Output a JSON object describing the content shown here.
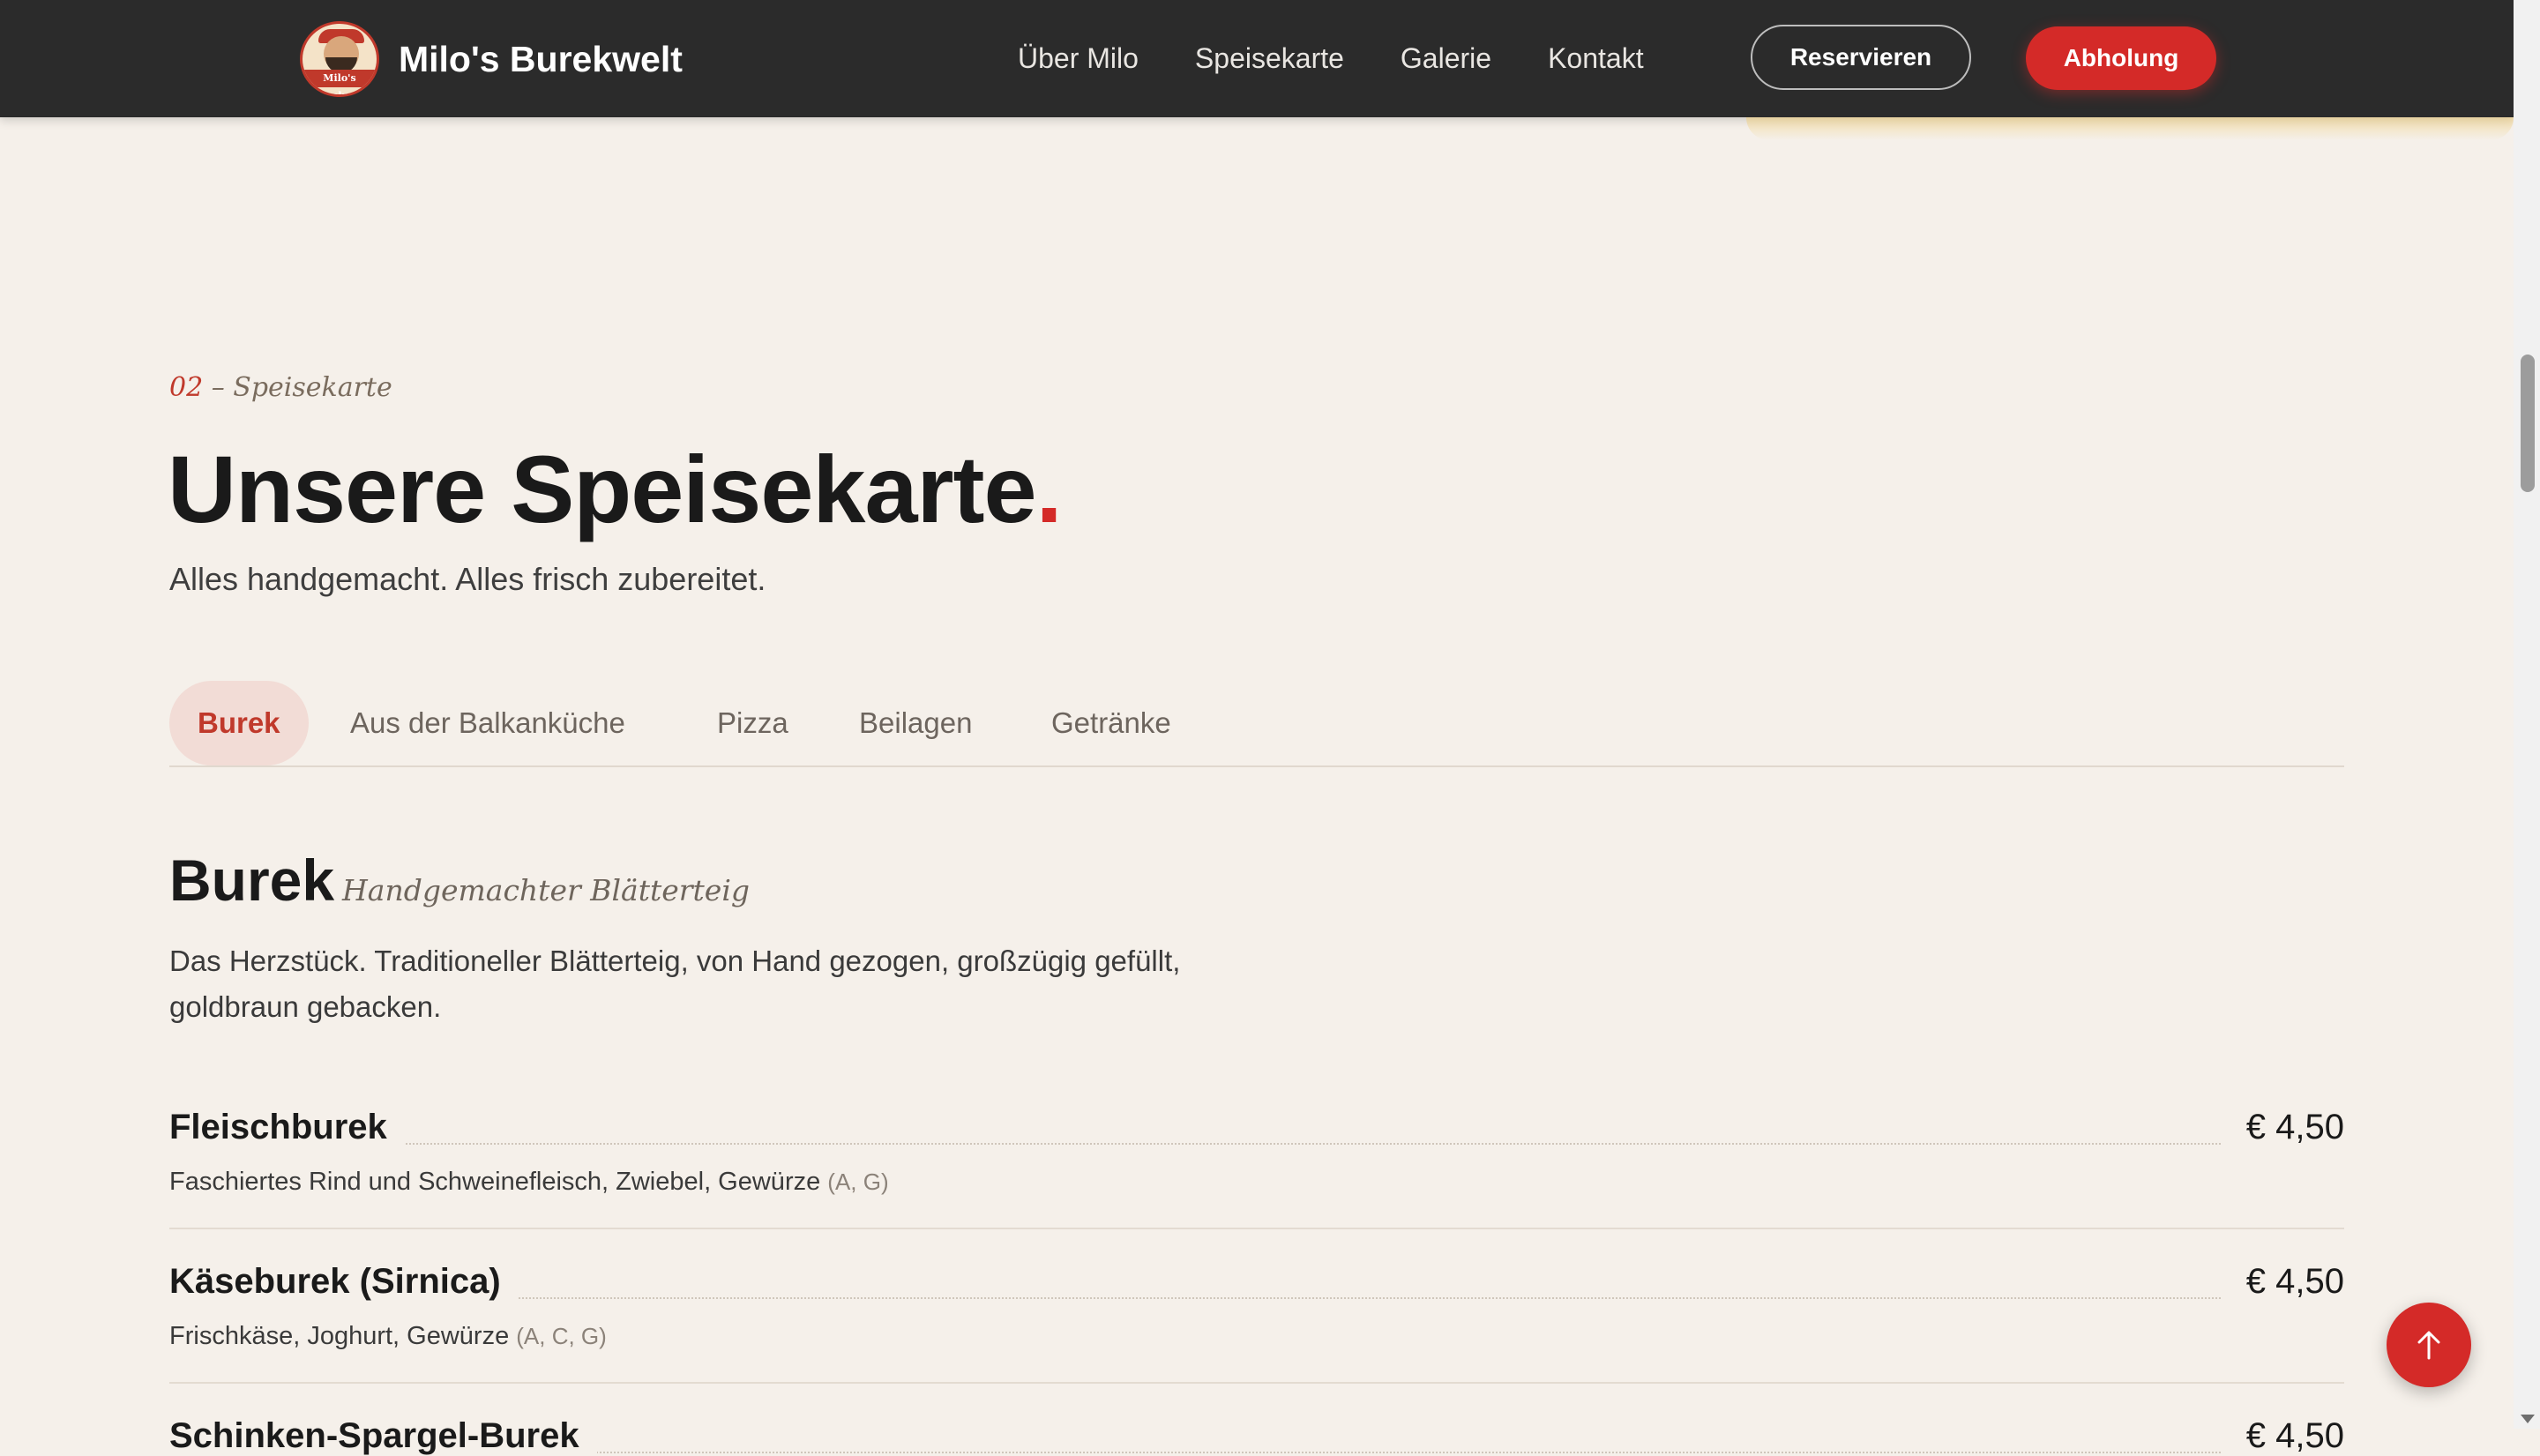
{
  "header": {
    "brand_name": "Milo's Burekwelt",
    "logo_text": "Milo's Burekwelt",
    "nav": [
      "Über Milo",
      "Speisekarte",
      "Galerie",
      "Kontakt"
    ],
    "reserve_label": "Reservieren",
    "pickup_label": "Abholung"
  },
  "section": {
    "eyebrow_num": "02",
    "eyebrow_sep": " – ",
    "eyebrow_text": "Speisekarte",
    "title": "Unsere Speisekarte",
    "title_dot": ".",
    "subtitle": "Alles handgemacht. Alles frisch zubereitet."
  },
  "tabs": [
    "Burek",
    "Aus der Balkanküche",
    "Pizza",
    "Beilagen",
    "Getränke"
  ],
  "category": {
    "title": "Burek",
    "subtitle": "Handgemachter Blätterteig",
    "description": "Das Herzstück. Traditioneller Blätterteig, von Hand gezogen, großzügig gefüllt, goldbraun gebacken."
  },
  "items": [
    {
      "name": "Fleischburek",
      "price": "€ 4,50",
      "desc": "Faschiertes Rind und Schweinefleisch, Zwiebel, Gewürze",
      "allergens": "(A, G)"
    },
    {
      "name": "Käseburek (Sirnica)",
      "price": "€ 4,50",
      "desc": "Frischkäse, Joghurt, Gewürze",
      "allergens": "(A, C, G)"
    },
    {
      "name": "Schinken-Spargel-Burek",
      "price": "€ 4,50",
      "desc": "",
      "allergens": ""
    }
  ],
  "colors": {
    "accent": "#d42a28",
    "header_bg": "#2b2b2b",
    "page_bg": "#f5f0ea"
  },
  "icons": {
    "to_top": "arrow-up-icon"
  }
}
